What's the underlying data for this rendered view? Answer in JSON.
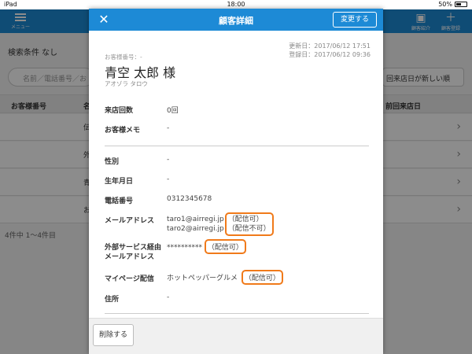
{
  "status_bar": {
    "device": "iPad",
    "time": "18:00",
    "battery": "50%"
  },
  "app_header": {
    "menu_label": "メニュー",
    "right_buttons": [
      {
        "label": "顧客紹介",
        "icon": "card-icon"
      },
      {
        "label": "顧客登録",
        "icon": "plus-icon"
      }
    ]
  },
  "background": {
    "filter_label": "検索条件 なし",
    "search_placeholder": "名前／電話番号／お",
    "sort_label": "回来店日が新しい順",
    "table_headers": [
      "お客様番号",
      "名",
      "前回来店日"
    ],
    "row_stubs": [
      "伝",
      "外",
      "青",
      "お"
    ],
    "count_text": "4件中 1〜4件目"
  },
  "modal": {
    "title": "顧客詳細",
    "change_button": "変更する",
    "updated": "更新日：2017/06/12 17:51",
    "registered": "登録日：2017/06/12 09:36",
    "customer_no": "お客様番号：-",
    "name": "青空 太郎 様",
    "kana": "アオゾラ タロウ",
    "visit_count_label": "来店回数",
    "visit_count": "0回",
    "memo_label": "お客様メモ",
    "memo": "-",
    "gender_label": "性別",
    "gender": "-",
    "birthday_label": "生年月日",
    "birthday": "-",
    "phone_label": "電話番号",
    "phone": "0312345678",
    "email_label": "メールアドレス",
    "emails": [
      {
        "address": "taro1@airregi.jp",
        "status": "（配信可）"
      },
      {
        "address": "taro2@airregi.jp",
        "status": "（配信不可）"
      }
    ],
    "ext_email_label_1": "外部サービス経由",
    "ext_email_label_2": "メールアドレス",
    "ext_email": "**********",
    "ext_email_status": "（配信可）",
    "mypage_label": "マイページ配信",
    "mypage": "ホットペッパーグルメ",
    "mypage_status": "（配信可）",
    "address_label": "住所",
    "address": "-",
    "delete_button": "削除する"
  }
}
